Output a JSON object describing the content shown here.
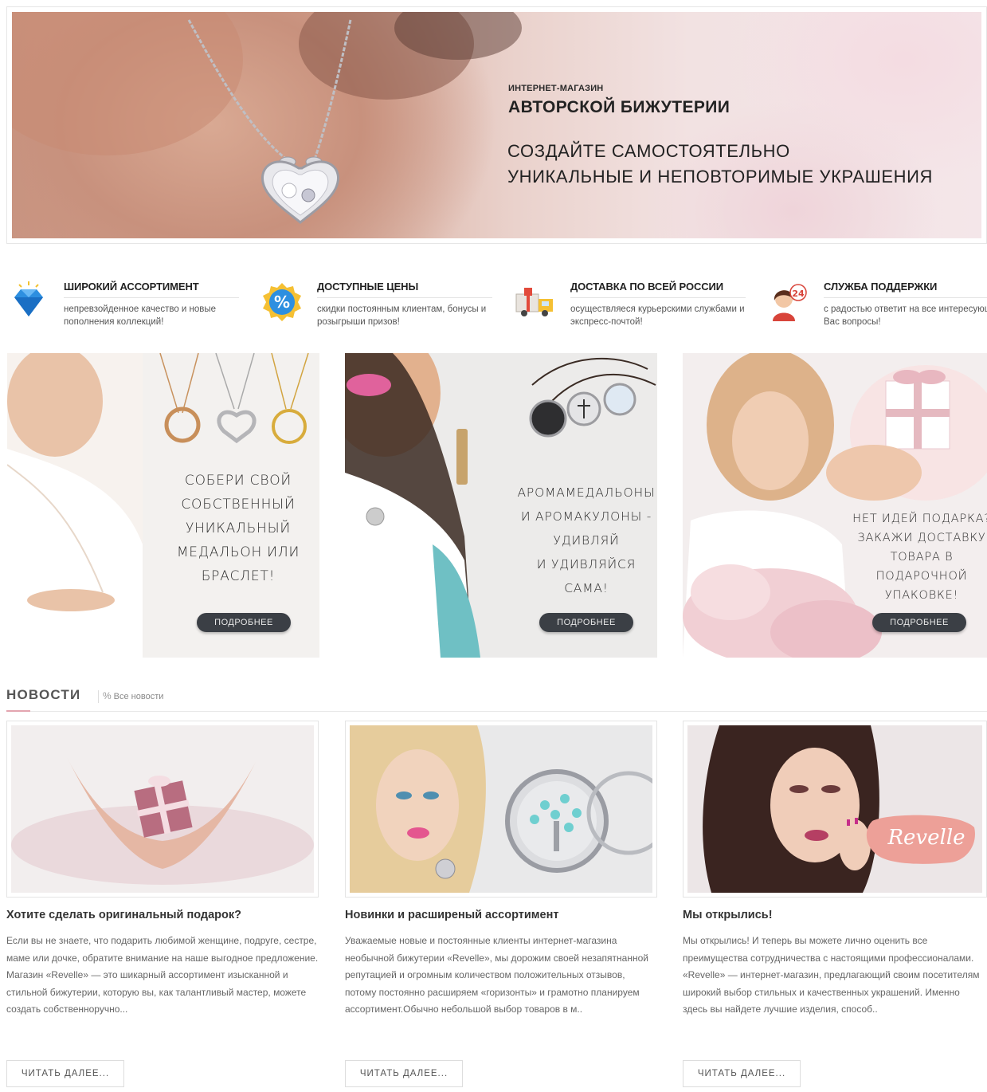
{
  "hero": {
    "small_caption": "ИНТЕРНЕТ-МАГАЗИН",
    "title": "АВТОРСКОЙ БИЖУТЕРИИ",
    "line1": "СОЗДАЙТЕ САМОСТОЯТЕЛЬНО",
    "line2": "УНИКАЛЬНЫЕ И НЕПОВТОРИМЫЕ УКРАШЕНИЯ"
  },
  "features": [
    {
      "icon": "diamond-icon",
      "title": "ШИРОКИЙ АССОРТИМЕНТ",
      "text": "непревзойденное качество и новые пополнения коллекций!"
    },
    {
      "icon": "percent-badge-icon",
      "title": "ДОСТУПНЫЕ ЦЕНЫ",
      "text": "скидки постоянным клиентам, бонусы и розыгрыши призов!"
    },
    {
      "icon": "delivery-truck-icon",
      "title": "ДОСТАВКА ПО ВСЕЙ РОССИИ",
      "text": "осуществляеся курьерскими службами и экспресс-почтой!"
    },
    {
      "icon": "support-24-icon",
      "title": "СЛУЖБА ПОДДЕРЖКИ",
      "text": "с радостью ответит на все интересующие Вас вопросы!"
    }
  ],
  "promos": [
    {
      "lines": [
        "СОБЕРИ СВОЙ",
        "СОБСТВЕННЫЙ",
        "УНИКАЛЬНЫЙ",
        "МЕДАЛЬОН ИЛИ",
        "БРАСЛЕТ!"
      ],
      "button": "ПОДРОБНЕЕ"
    },
    {
      "lines": [
        "АРОМАМЕДАЛЬОНЫ",
        "И АРОМАКУЛОНЫ -",
        "УДИВЛЯЙ",
        "И УДИВЛЯЙСЯ САМА!"
      ],
      "button": "ПОДРОБНЕЕ"
    },
    {
      "lines": [
        "НЕТ ИДЕЙ ПОДАРКА?",
        "ЗАКАЖИ ДОСТАВКУ",
        "ТОВАРА В",
        "ПОДАРОЧНОЙ",
        "УПАКОВКЕ!"
      ],
      "button": "ПОДРОБНЕЕ"
    }
  ],
  "news": {
    "title": "НОВОСТИ",
    "all_link": "Все новости",
    "items": [
      {
        "title": "Хотите сделать оригинальный подарок?",
        "text": "Если вы не знаете, что подарить любимой женщине, подруге, сестре, маме или дочке, обратите внимание на наше выгодное предложение. Магазин «Revelle» — это шикарный ассортимент изысканной и стильной бижутерии, которую вы, как талантливый мастер, можете создать собственноручно...",
        "more": "ЧИТАТЬ ДАЛЕЕ..."
      },
      {
        "title": "Новинки и расширеный ассортимент",
        "text": "Уважаемые новые и постоянные клиенты интернет-магазина необычной бижутерии «Revelle», мы дорожим своей незапятнанной репутацией и огромным количеством положительных отзывов, потому постоянно расширяем «горизонты» и грамотно планируем ассортимент.Обычно небольшой выбор товаров в м..",
        "more": "ЧИТАТЬ ДАЛЕЕ..."
      },
      {
        "title": "Мы открылись!",
        "text": "Мы открылись! И теперь вы можете лично оценить все преимущества сотрудничества с настоящими профессионалами. «Revelle» — интернет-магазин, предлагающий своим посетителям широкий выбор стильных и качественных украшений. Именно здесь вы найдете лучшие изделия, способ..",
        "more": "ЧИТАТЬ ДАЛЕЕ...",
        "logo_text": "Revelle"
      }
    ]
  },
  "colors": {
    "accent_pink": "#e3a5b0",
    "button_dark": "#3b3f45"
  }
}
